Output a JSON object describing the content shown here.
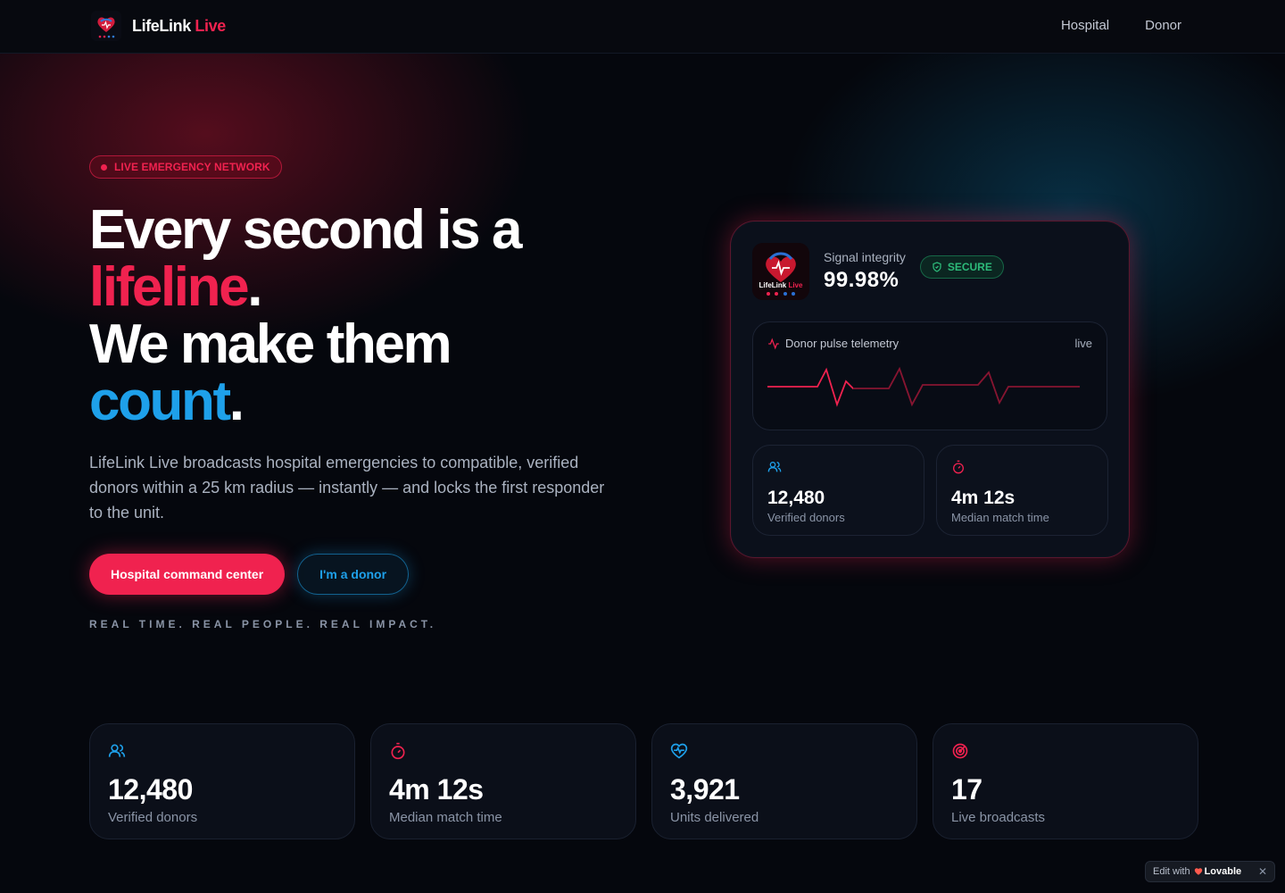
{
  "nav": {
    "brand_main": "LifeLink",
    "brand_accent": "Live",
    "links": [
      "Hospital",
      "Donor"
    ]
  },
  "hero": {
    "badge": "LIVE EMERGENCY NETWORK",
    "line1": "Every second is a",
    "line2_accent": "lifeline",
    "line2_end": ".",
    "line3": "We make them",
    "line4_accent": "count",
    "line4_end": ".",
    "description": "LifeLink Live broadcasts hospital emergencies to compatible, verified donors within a 25 km radius — instantly — and locks the first responder to the unit.",
    "primary_cta": "Hospital command center",
    "secondary_cta": "I'm a donor",
    "tagline": "REAL TIME. REAL PEOPLE. REAL IMPACT."
  },
  "panel": {
    "signal_label": "Signal integrity",
    "signal_value": "99.98%",
    "secure_label": "SECURE",
    "telemetry_title": "Donor pulse telemetry",
    "telemetry_status": "live",
    "mini": [
      {
        "icon": "users-icon",
        "value": "12,480",
        "label": "Verified donors"
      },
      {
        "icon": "timer-icon",
        "value": "4m 12s",
        "label": "Median match time"
      }
    ]
  },
  "stats": [
    {
      "icon": "users-icon",
      "value": "12,480",
      "label": "Verified donors"
    },
    {
      "icon": "timer-icon",
      "value": "4m 12s",
      "label": "Median match time"
    },
    {
      "icon": "heart-pulse-icon",
      "value": "3,921",
      "label": "Units delivered"
    },
    {
      "icon": "radar-icon",
      "value": "17",
      "label": "Live broadcasts"
    }
  ],
  "badge": {
    "edit_text": "Edit with",
    "brand": "Lovable"
  },
  "colors": {
    "accent_red": "#f0224f",
    "accent_blue": "#1ea0ea",
    "secure_green": "#2dbb7a",
    "background": "#05070d"
  }
}
